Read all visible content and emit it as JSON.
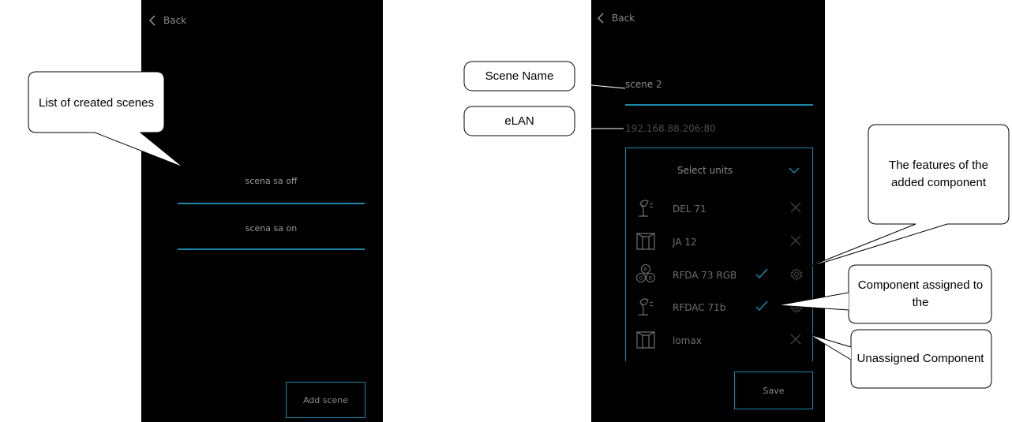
{
  "left_screen": {
    "back_label": "Back",
    "scenes": [
      "scena sa off",
      "scena sa on"
    ],
    "add_button_label": "Add scene"
  },
  "right_screen": {
    "back_label": "Back",
    "scene_name_value": "scene 2",
    "elan_value": "192.168.88.206:80",
    "units_title": "Select units",
    "units": [
      {
        "label": "DEL 71",
        "icon": "lamp-icon",
        "assigned": false
      },
      {
        "label": "JA 12",
        "icon": "blinds-icon",
        "assigned": false
      },
      {
        "label": "RFDA 73 RGB",
        "icon": "rgb-icon",
        "assigned": true
      },
      {
        "label": "RFDAC 71b",
        "icon": "lamp-icon",
        "assigned": true
      },
      {
        "label": "lomax",
        "icon": "blinds-icon",
        "assigned": false
      }
    ],
    "save_label": "Save"
  },
  "callouts": {
    "list_of_scenes": "List of created scenes",
    "scene_name": "Scene Name",
    "elan": "eLAN",
    "features": "The features of the added component",
    "assigned": "Component assigned to the",
    "unassigned": "Unassigned Component"
  },
  "colors": {
    "accent": "#1a86a8",
    "screen_bg": "#000000"
  }
}
